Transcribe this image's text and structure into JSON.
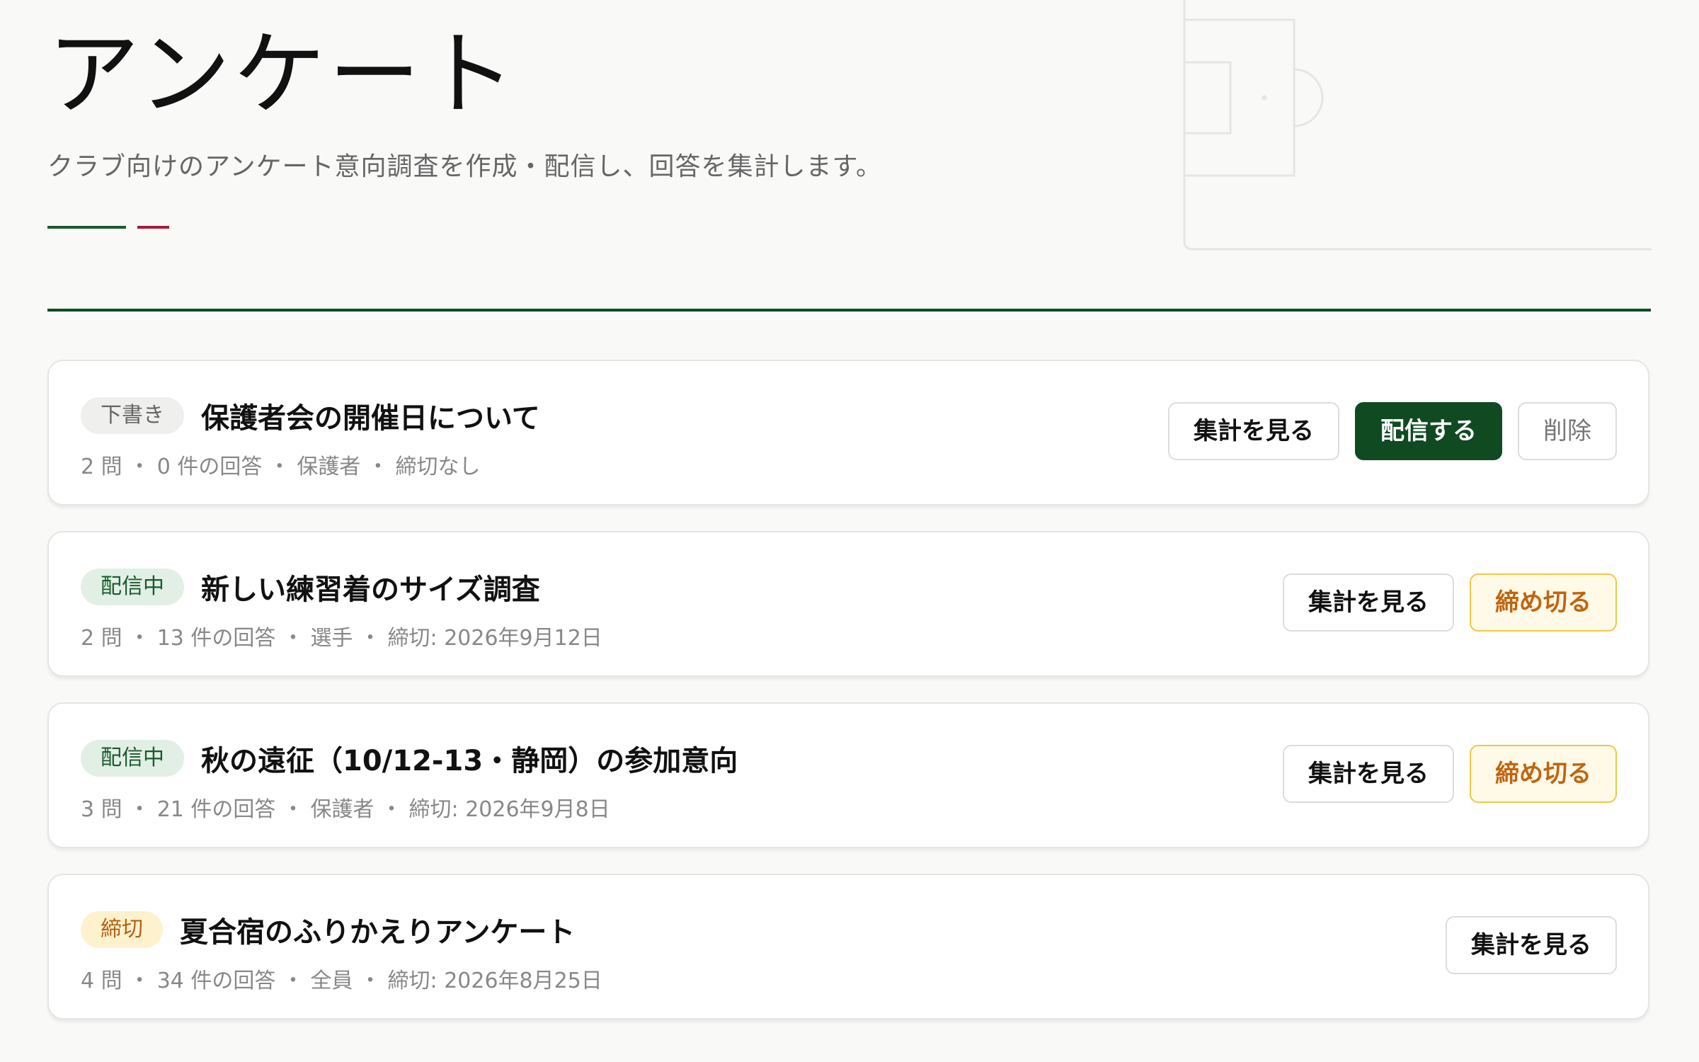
{
  "page": {
    "title": "アンケート",
    "subtitle": "クラブ向けのアンケート意向調査を作成・配信し、回答を集計します。"
  },
  "colors": {
    "brand_green": "#0f4a21",
    "accent_red": "#a31c3c",
    "warn": "#f0c843"
  },
  "surveys": [
    {
      "status": "下書き",
      "title": "保護者会の開催日について",
      "meta": "2 問 ・ 0 件の回答 ・ 保護者 ・ 締切なし",
      "actions": {
        "view": "集計を見る",
        "publish": "配信する",
        "delete": "削除"
      }
    },
    {
      "status": "配信中",
      "title": "新しい練習着のサイズ調査",
      "meta": "2 問 ・ 13 件の回答 ・ 選手 ・ 締切: 2026年9月12日",
      "actions": {
        "view": "集計を見る",
        "close": "締め切る"
      }
    },
    {
      "status": "配信中",
      "title": "秋の遠征（10/12-13・静岡）の参加意向",
      "meta": "3 問 ・ 21 件の回答 ・ 保護者 ・ 締切: 2026年9月8日",
      "actions": {
        "view": "集計を見る",
        "close": "締め切る"
      }
    },
    {
      "status": "締切",
      "title": "夏合宿のふりかえりアンケート",
      "meta": "4 問 ・ 34 件の回答 ・ 全員 ・ 締切: 2026年8月25日",
      "actions": {
        "view": "集計を見る"
      }
    }
  ]
}
